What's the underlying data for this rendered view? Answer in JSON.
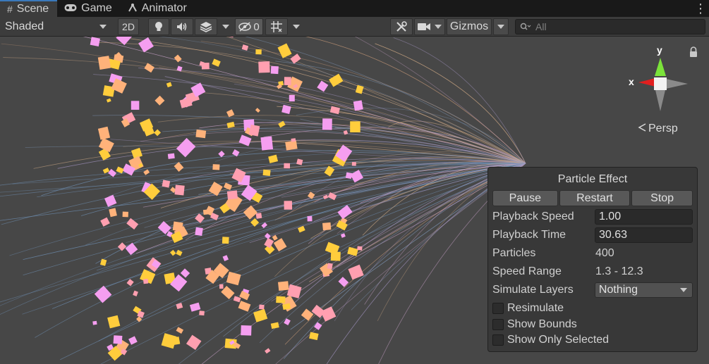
{
  "tabs": [
    {
      "label": "Scene",
      "icon": "hash-icon",
      "active": true
    },
    {
      "label": "Game",
      "icon": "gamepad-icon",
      "active": false
    },
    {
      "label": "Animator",
      "icon": "animator-icon",
      "active": false
    }
  ],
  "toolbar": {
    "shading_mode": "Shaded",
    "mode_2d_label": "2D",
    "hidden_count": "0",
    "gizmos_label": "Gizmos",
    "search_placeholder": "All"
  },
  "gizmo": {
    "y_label": "y",
    "x_label": "x",
    "projection_label": "Persp"
  },
  "particle_panel": {
    "title": "Particle Effect",
    "buttons": {
      "pause": "Pause",
      "restart": "Restart",
      "stop": "Stop"
    },
    "playback_speed_label": "Playback Speed",
    "playback_speed_value": "1.00",
    "playback_time_label": "Playback Time",
    "playback_time_value": "30.63",
    "particles_label": "Particles",
    "particles_value": "400",
    "speed_range_label": "Speed Range",
    "speed_range_value": "1.3 - 12.3",
    "simulate_layers_label": "Simulate Layers",
    "simulate_layers_value": "Nothing",
    "checkboxes": {
      "resimulate": "Resimulate",
      "show_bounds": "Show Bounds",
      "show_only_selected": "Show Only Selected"
    }
  },
  "colors": {
    "accent_tab": "#3a79bb",
    "particle_pink": "#f59ef0",
    "particle_orange": "#ffb27a",
    "particle_yellow": "#ffcd3c",
    "gizmo_y": "#7be33a",
    "gizmo_x": "#e11f1f"
  }
}
